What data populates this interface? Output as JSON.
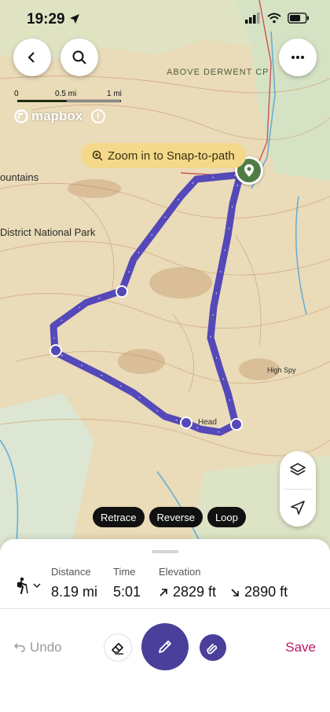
{
  "status_bar": {
    "time": "19:29"
  },
  "map": {
    "scale_labels": [
      "0",
      "0.5 mi",
      "1 mi"
    ],
    "attribution": "mapbox",
    "snap_hint": "Zoom in to Snap-to-path",
    "labels": {
      "above_derwent": "ABOVE DERWENT CP",
      "national_park": "District National Park",
      "mountains": "ountains",
      "head": "Head",
      "high_spy": "High Spy"
    }
  },
  "route_actions": {
    "retrace": "Retrace",
    "reverse": "Reverse",
    "loop": "Loop"
  },
  "stats": {
    "distance_label": "Distance",
    "distance_value": "8.19 mi",
    "time_label": "Time",
    "time_value": "5:01",
    "elevation_label": "Elevation",
    "ascent_value": "2829 ft",
    "descent_value": "2890 ft"
  },
  "toolbar": {
    "undo_label": "Undo",
    "save_label": "Save"
  },
  "colors": {
    "route": "#5548b8",
    "accent": "#4a3f9a",
    "save": "#b8185e",
    "pin": "#4f7c45",
    "snap_pill": "#f4d98a"
  }
}
